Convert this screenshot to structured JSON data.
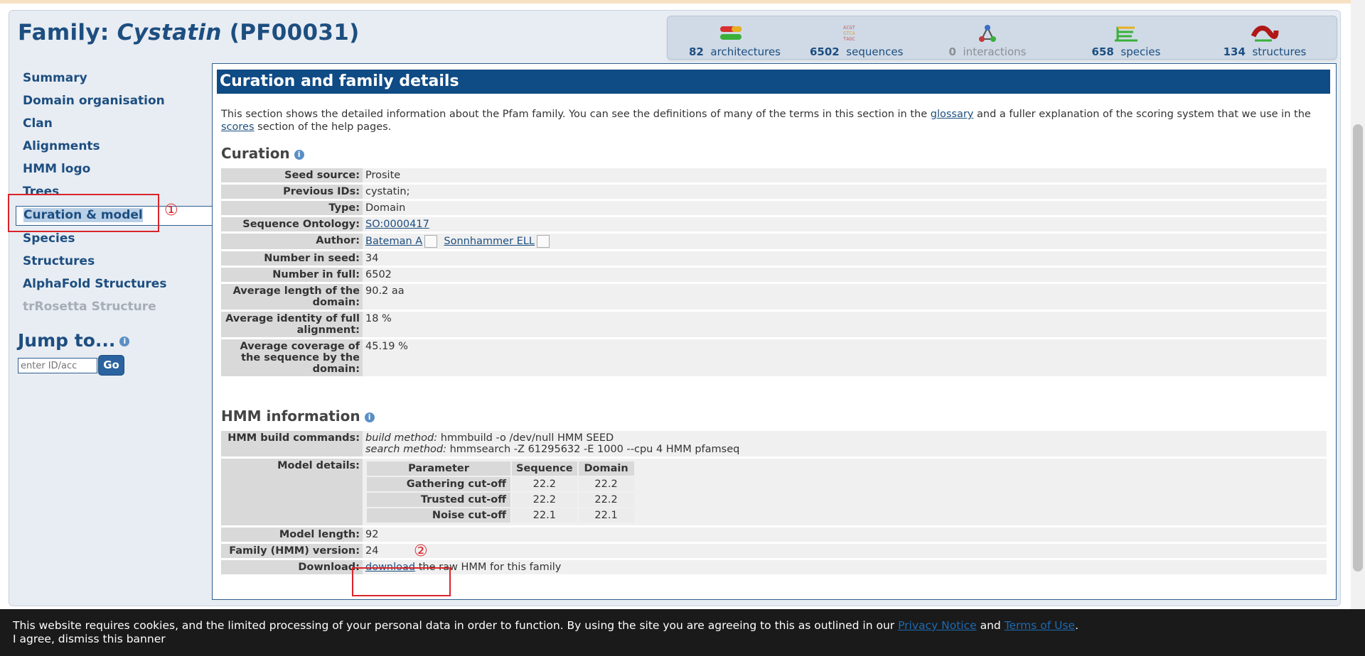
{
  "header": {
    "title_prefix": "Family: ",
    "family_name": "Cystatin",
    "accession": " (PF00031)"
  },
  "stats": [
    {
      "num": "82",
      "label": "architectures",
      "icon": "architectures-icon"
    },
    {
      "num": "6502",
      "label": "sequences",
      "icon": "sequences-icon"
    },
    {
      "num": "0",
      "label": "interactions",
      "icon": "interactions-icon"
    },
    {
      "num": "658",
      "label": "species",
      "icon": "species-icon"
    },
    {
      "num": "134",
      "label": "structures",
      "icon": "structures-icon"
    }
  ],
  "sidebar": {
    "items": [
      {
        "label": "Summary"
      },
      {
        "label": "Domain organisation"
      },
      {
        "label": "Clan"
      },
      {
        "label": "Alignments"
      },
      {
        "label": "HMM logo"
      },
      {
        "label": "Trees"
      },
      {
        "label": "Curation & model"
      },
      {
        "label": "Species"
      },
      {
        "label": "Structures"
      },
      {
        "label": "AlphaFold Structures"
      },
      {
        "label": "trRosetta Structure"
      }
    ],
    "jump_title": "Jump to...",
    "jump_placeholder": "enter ID/acc",
    "go_label": "Go"
  },
  "main": {
    "heading": "Curation and family details",
    "intro_part1": "This section shows the detailed information about the Pfam family. You can see the definitions of many of the terms in this section in the ",
    "glossary_link": "glossary",
    "intro_part2": " and a fuller explanation of the scoring system that we use in the ",
    "scores_link": "scores",
    "intro_part3": " section of the help pages.",
    "curation_title": "Curation",
    "curation": {
      "seed_source_k": "Seed source:",
      "seed_source_v": "Prosite",
      "previous_ids_k": "Previous IDs:",
      "previous_ids_v": "cystatin;",
      "type_k": "Type:",
      "type_v": "Domain",
      "so_k": "Sequence Ontology:",
      "so_v": "SO:0000417",
      "author_k": "Author:",
      "author_1": "Bateman A",
      "author_2": "Sonnhammer ELL",
      "num_seed_k": "Number in seed:",
      "num_seed_v": "34",
      "num_full_k": "Number in full:",
      "num_full_v": "6502",
      "avg_len_k": "Average length of the domain:",
      "avg_len_v": "90.2 aa",
      "avg_id_k": "Average identity of full alignment:",
      "avg_id_v": "18 %",
      "avg_cov_k": "Average coverage of the sequence by the domain:",
      "avg_cov_v": "45.19 %"
    },
    "hmm_title": "HMM information",
    "hmm": {
      "build_k": "HMM build commands:",
      "build_method_label": "build method:",
      "build_method_v": " hmmbuild -o /dev/null HMM SEED",
      "search_method_label": "search method:",
      "search_method_v": " hmmsearch -Z 61295632 -E 1000 --cpu 4 HMM pfamseq",
      "model_details_k": "Model details:",
      "param_headers": [
        "Parameter",
        "Sequence",
        "Domain"
      ],
      "params": [
        {
          "name": "Gathering cut-off",
          "seq": "22.2",
          "dom": "22.2"
        },
        {
          "name": "Trusted cut-off",
          "seq": "22.2",
          "dom": "22.2"
        },
        {
          "name": "Noise cut-off",
          "seq": "22.1",
          "dom": "22.1"
        }
      ],
      "model_length_k": "Model length:",
      "model_length_v": "92",
      "version_k": "Family (HMM) version:",
      "version_v": "24",
      "download_k": "Download:",
      "download_link": "download",
      "download_rest": " the raw HMM for this family"
    }
  },
  "annotations": {
    "one": "①",
    "two": "②"
  },
  "cookie": {
    "text1": "This website requires cookies, and the limited processing of your personal data in order to function. By using the site you are agreeing to this as outlined in our ",
    "privacy": "Privacy Notice",
    "and": " and ",
    "terms": "Terms of Use",
    "end": ".",
    "dismiss": "I agree, dismiss this banner"
  },
  "colors": {
    "brand": "#1d4e80",
    "header_bar": "#0f4b84",
    "annotation": "#d9242a"
  }
}
